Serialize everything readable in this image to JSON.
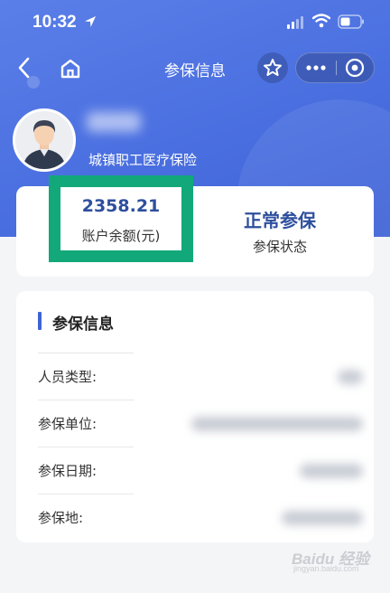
{
  "status_bar": {
    "time": "10:32"
  },
  "nav": {
    "title": "参保信息"
  },
  "profile": {
    "insurance_type": "城镇职工医疗保险"
  },
  "summary": {
    "balance_value": "2358.21",
    "balance_label": "账户余额(元)",
    "status_value": "正常参保",
    "status_label": "参保状态"
  },
  "info": {
    "section_title": "参保信息",
    "rows": [
      {
        "label": "人员类型:"
      },
      {
        "label": "参保单位:"
      },
      {
        "label": "参保日期:"
      },
      {
        "label": "参保地:"
      }
    ]
  },
  "watermark": {
    "text": "Baidu 经验",
    "sub": "jingyan.baidu.com"
  },
  "colors": {
    "header_blue": "#4a6fe0",
    "accent_navy": "#2e4f9e",
    "highlight_green": "#12a87a",
    "section_bar": "#3f63d6"
  },
  "icons": [
    "location-arrow-icon",
    "signal-icon",
    "wifi-icon",
    "battery-icon",
    "back-chevron-icon",
    "home-icon",
    "star-icon",
    "more-dots-icon",
    "close-target-icon",
    "avatar-icon"
  ]
}
